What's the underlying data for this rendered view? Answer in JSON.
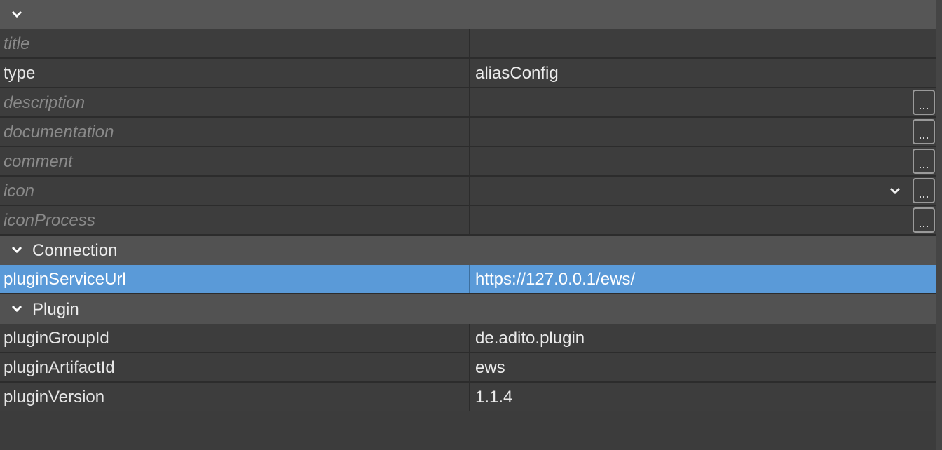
{
  "sections": {
    "connection": "Connection",
    "plugin": "Plugin"
  },
  "rows": [
    {
      "name": "title",
      "value": ""
    },
    {
      "name": "type",
      "value": "aliasConfig"
    },
    {
      "name": "description",
      "value": ""
    },
    {
      "name": "documentation",
      "value": ""
    },
    {
      "name": "comment",
      "value": ""
    },
    {
      "name": "icon",
      "value": ""
    },
    {
      "name": "iconProcess",
      "value": ""
    },
    {
      "name": "pluginServiceUrl",
      "value": "https://127.0.0.1/ews/"
    },
    {
      "name": "pluginGroupId",
      "value": "de.adito.plugin"
    },
    {
      "name": "pluginArtifactId",
      "value": "ews"
    },
    {
      "name": "pluginVersion",
      "value": "1.1.4"
    }
  ],
  "button_label": "...",
  "colors": {
    "selection": "#5a9ad8",
    "background": "#3c3c3c",
    "group_header": "#525252"
  }
}
